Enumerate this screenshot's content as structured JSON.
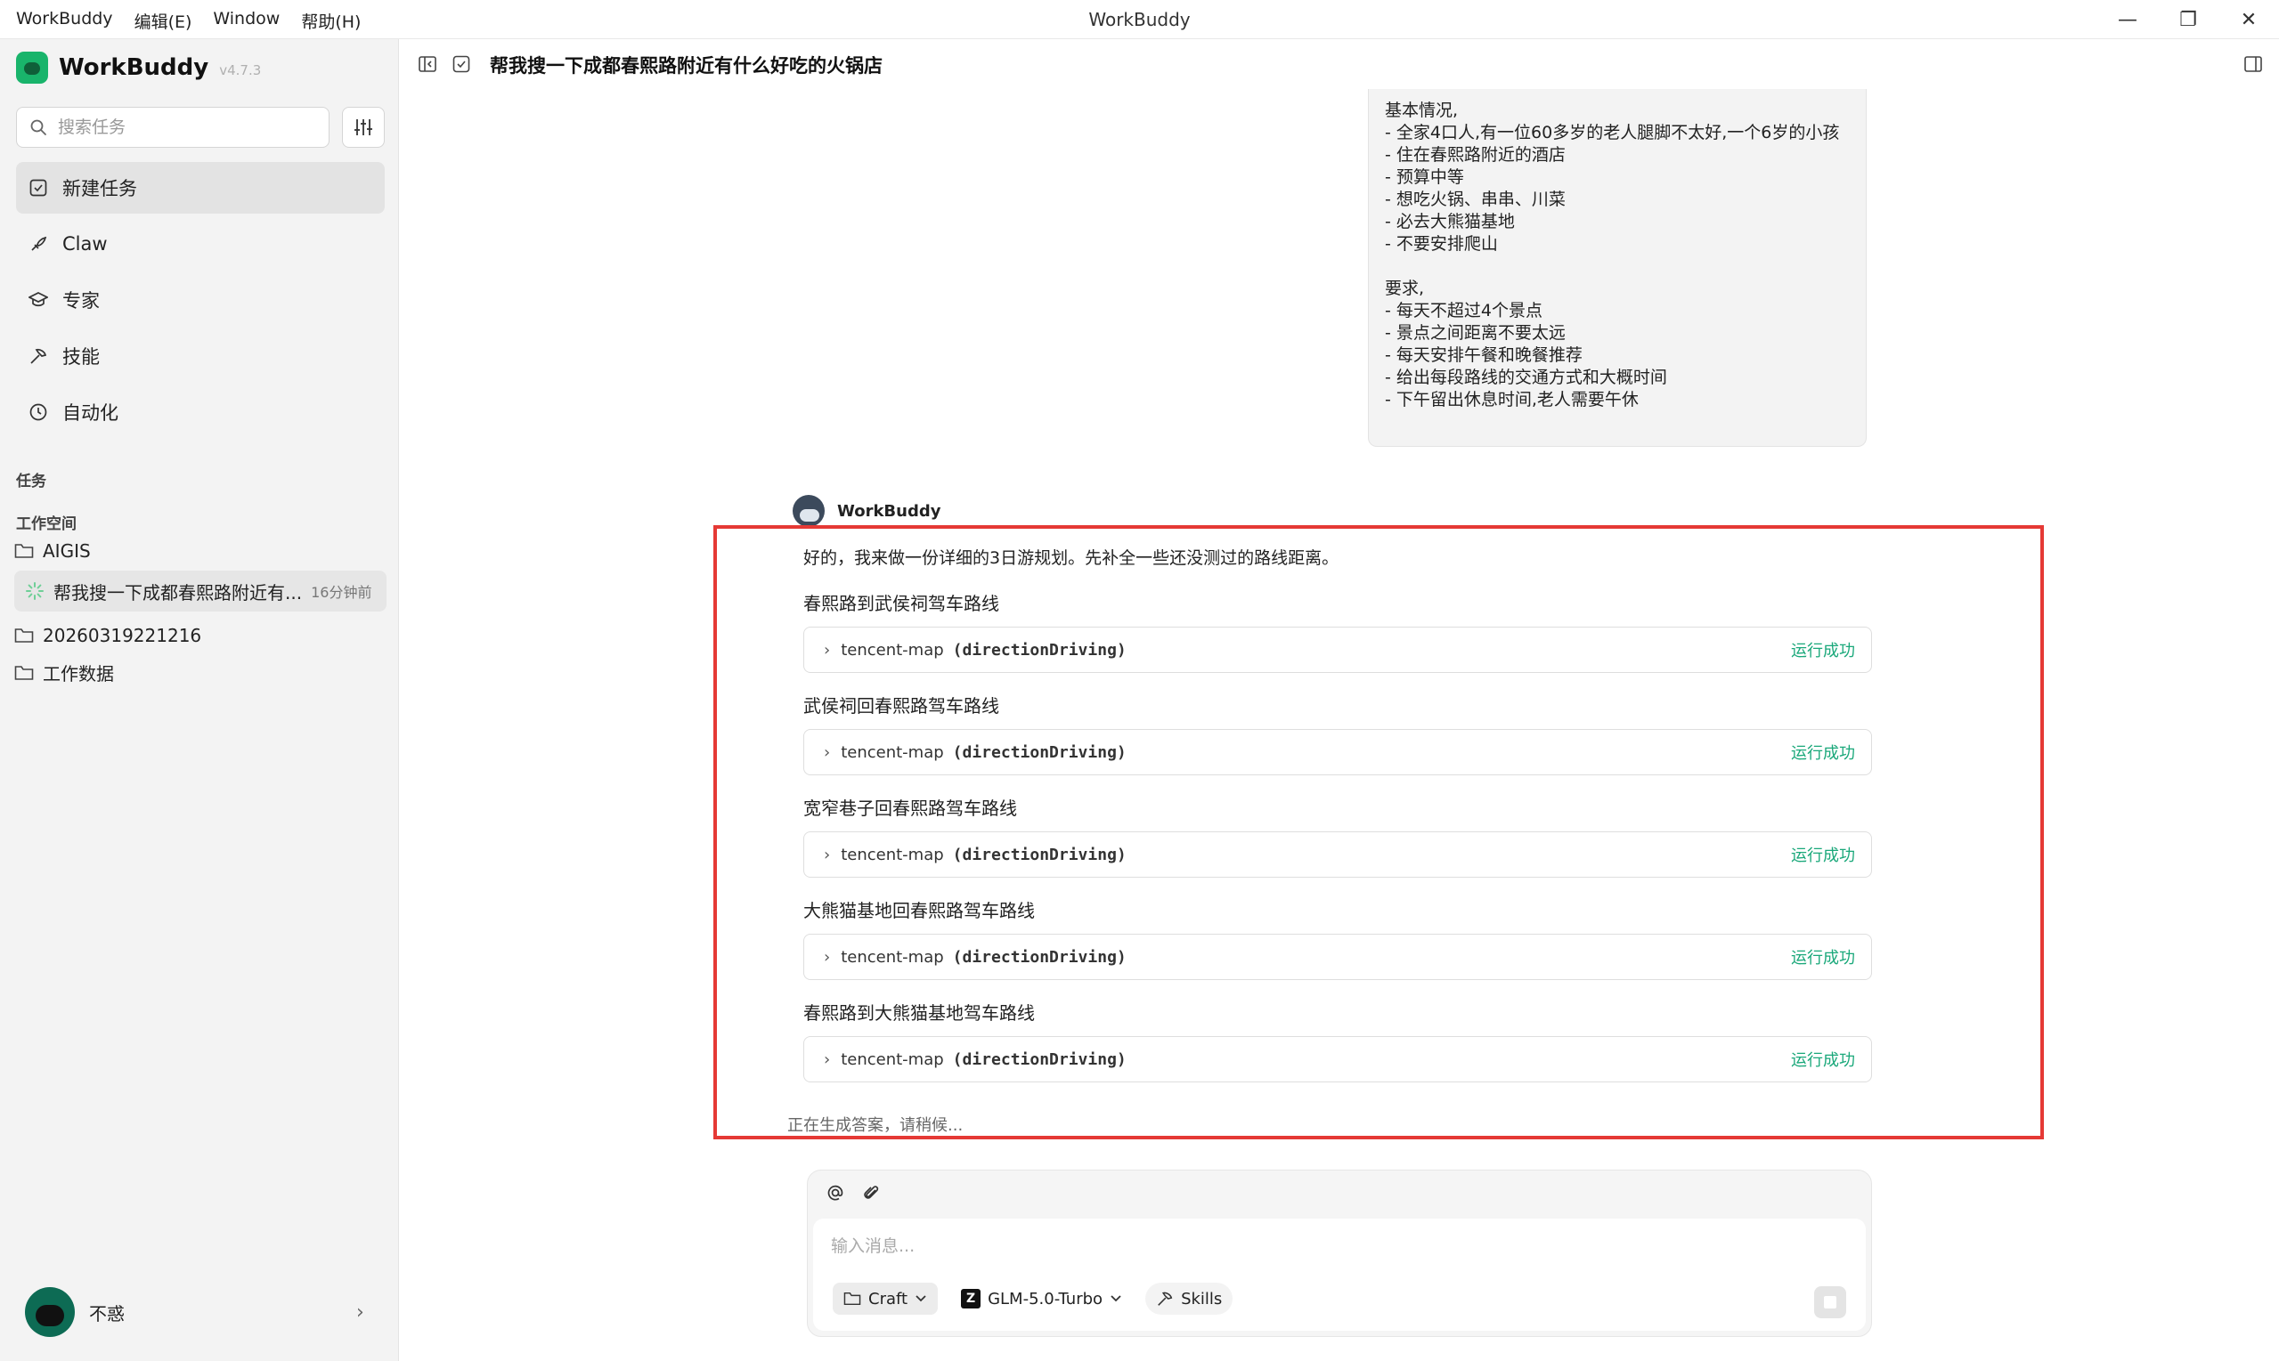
{
  "window": {
    "title": "WorkBuddy",
    "menu": [
      "WorkBuddy",
      "编辑(E)",
      "Window",
      "帮助(H)"
    ],
    "controls": {
      "minimize": "—",
      "restore": "❐",
      "close": "✕"
    }
  },
  "sidebar": {
    "brand": {
      "name": "WorkBuddy",
      "version": "v4.7.3"
    },
    "search": {
      "placeholder": "搜索任务"
    },
    "nav": [
      {
        "label": "新建任务",
        "icon": "new-task-icon"
      },
      {
        "label": "Claw",
        "icon": "claw-icon"
      },
      {
        "label": "专家",
        "icon": "expert-icon"
      },
      {
        "label": "技能",
        "icon": "skills-icon"
      },
      {
        "label": "自动化",
        "icon": "clock-icon"
      }
    ],
    "tasks_label": "任务",
    "workspace_label": "工作空间",
    "workspaces": [
      "AIGIS",
      "20260319221216",
      "工作数据"
    ],
    "active_task": {
      "title": "帮我搜一下成都春熙路附近有...",
      "time": "16分钟前"
    },
    "user": {
      "name": "不惑"
    }
  },
  "chat": {
    "title": "帮我搜一下成都春熙路附近有什么好吃的火锅店",
    "user_message_lines": [
      "基本情况,",
      "- 全家4口人,有一位60多岁的老人腿脚不太好,一个6岁的小孩",
      "- 住在春熙路附近的酒店",
      "- 预算中等",
      "- 想吃火锅、串串、川菜",
      "- 必去大熊猫基地",
      "- 不要安排爬山",
      "",
      "要求,",
      "- 每天不超过4个景点",
      "- 景点之间距离不要太远",
      "- 每天安排午餐和晚餐推荐",
      "- 给出每段路线的交通方式和大概时间",
      "- 下午留出休息时间,老人需要午休"
    ],
    "bot_name": "WorkBuddy",
    "bot_intro": "好的，我来做一份详细的3日游规划。先补全一些还没测过的路线距离。",
    "steps": [
      {
        "title": "春熙路到武侯祠驾车路线",
        "tool": "tencent-map",
        "func": "(directionDriving)",
        "status": "运行成功"
      },
      {
        "title": "武侯祠回春熙路驾车路线",
        "tool": "tencent-map",
        "func": "(directionDriving)",
        "status": "运行成功"
      },
      {
        "title": "宽窄巷子回春熙路驾车路线",
        "tool": "tencent-map",
        "func": "(directionDriving)",
        "status": "运行成功"
      },
      {
        "title": "大熊猫基地回春熙路驾车路线",
        "tool": "tencent-map",
        "func": "(directionDriving)",
        "status": "运行成功"
      },
      {
        "title": "春熙路到大熊猫基地驾车路线",
        "tool": "tencent-map",
        "func": "(directionDriving)",
        "status": "运行成功"
      }
    ],
    "generating": "正在生成答案，请稍候..."
  },
  "composer": {
    "placeholder": "输入消息...",
    "mode": "Craft",
    "model_badge": "Z",
    "model": "GLM-5.0-Turbo",
    "skills": "Skills"
  },
  "colors": {
    "accent": "#19b46b",
    "success": "#1aa87a",
    "highlight": "#e53935"
  }
}
